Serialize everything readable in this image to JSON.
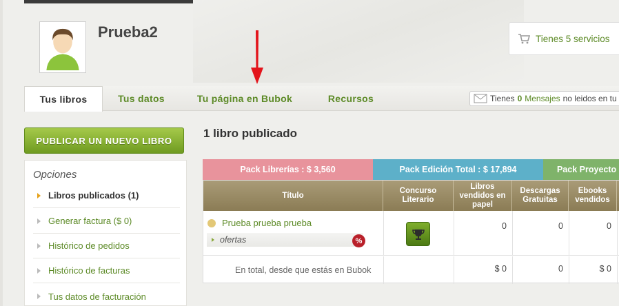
{
  "header": {
    "username": "Prueba2",
    "services_text": "Tienes 5 servicios"
  },
  "tabs": [
    {
      "label": "Tus libros"
    },
    {
      "label": "Tus datos"
    },
    {
      "label": "Tu página en Bubok"
    },
    {
      "label": "Recursos"
    }
  ],
  "messages": {
    "prefix": "Tienes",
    "count": "0",
    "link": "Mensajes",
    "suffix": "no leidos en tu"
  },
  "sidebar": {
    "publish_button": "PUBLICAR UN NUEVO LIBRO",
    "options_title": "Opciones",
    "items": [
      {
        "label": "Libros publicados (1)"
      },
      {
        "label": "Generar factura ($ 0)"
      },
      {
        "label": "Histórico de pedidos"
      },
      {
        "label": "Histórico de facturas"
      },
      {
        "label": "Tus datos de facturación"
      }
    ]
  },
  "main": {
    "title": "1 libro publicado",
    "packs": [
      {
        "label": "Pack Librerías : $ 3,560",
        "color": "#e8939c"
      },
      {
        "label": "Pack Edición Total : $ 17,894",
        "color": "#5db0c9"
      },
      {
        "label": "Pack Proyecto",
        "color": "#7fb36a"
      }
    ],
    "columns": [
      "Título",
      "Concurso Literario",
      "Libros vendidos en papel",
      "Descargas Gratuitas",
      "Ebooks vendidos"
    ],
    "row": {
      "title": "Prueba prueba prueba",
      "ofertas": "ofertas",
      "badge": "%",
      "papel": "0",
      "descargas": "0",
      "ebooks": "0"
    },
    "total": {
      "label": "En total, desde que estás en Bubok",
      "papel": "$ 0",
      "descargas": "0",
      "ebooks": "$ 0"
    }
  },
  "colors": {
    "accent_green": "#5c8a26",
    "header_tan": "#9b8d66",
    "arrow_red": "#e3141b"
  }
}
